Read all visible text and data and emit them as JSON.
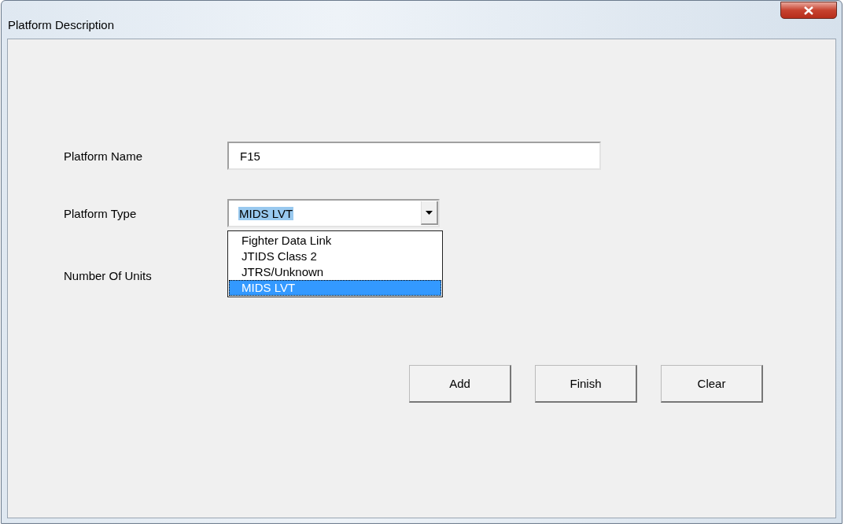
{
  "window": {
    "title": "Platform Description"
  },
  "platform_name": {
    "label": "Platform Name",
    "value": "F15"
  },
  "platform_type": {
    "label": "Platform Type",
    "value": "MIDS LVT",
    "text_selected": true,
    "expanded": true,
    "options": [
      {
        "label": "Fighter Data Link",
        "selected": false
      },
      {
        "label": "JTIDS Class 2",
        "selected": false
      },
      {
        "label": "JTRS/Unknown",
        "selected": false
      },
      {
        "label": "MIDS LVT",
        "selected": true
      }
    ]
  },
  "number_of_units": {
    "label": "Number Of Units"
  },
  "buttons": [
    {
      "label": "Add"
    },
    {
      "label": "Finish"
    },
    {
      "label": "Clear"
    }
  ]
}
